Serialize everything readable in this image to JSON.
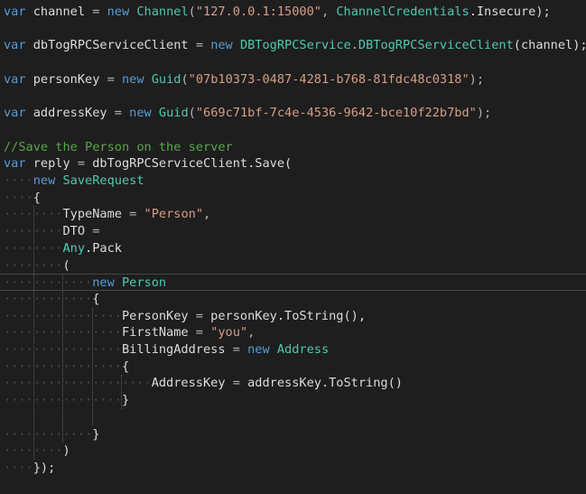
{
  "code": {
    "language": "csharp",
    "lines": [
      [
        {
          "t": "var",
          "c": "kw"
        },
        {
          "t": " channel ",
          "c": "id"
        },
        {
          "t": "=",
          "c": "pun"
        },
        {
          "t": " ",
          "c": "id"
        },
        {
          "t": "new",
          "c": "kw"
        },
        {
          "t": " ",
          "c": "id"
        },
        {
          "t": "Channel",
          "c": "typ"
        },
        {
          "t": "(",
          "c": "pun"
        },
        {
          "t": "\"127.0.0.1:15000\"",
          "c": "str"
        },
        {
          "t": ", ",
          "c": "pun"
        },
        {
          "t": "ChannelCredentials",
          "c": "typ"
        },
        {
          "t": ".Insecure);",
          "c": "id"
        }
      ],
      [],
      [
        {
          "t": "var",
          "c": "kw"
        },
        {
          "t": " dbTogRPCServiceClient ",
          "c": "id"
        },
        {
          "t": "=",
          "c": "pun"
        },
        {
          "t": " ",
          "c": "id"
        },
        {
          "t": "new",
          "c": "kw"
        },
        {
          "t": " ",
          "c": "id"
        },
        {
          "t": "DBTogRPCService",
          "c": "typ"
        },
        {
          "t": ".",
          "c": "pun"
        },
        {
          "t": "DBTogRPCServiceClient",
          "c": "typ"
        },
        {
          "t": "(channel);",
          "c": "id"
        }
      ],
      [],
      [
        {
          "t": "var",
          "c": "kw"
        },
        {
          "t": " personKey ",
          "c": "id"
        },
        {
          "t": "=",
          "c": "pun"
        },
        {
          "t": " ",
          "c": "id"
        },
        {
          "t": "new",
          "c": "kw"
        },
        {
          "t": " ",
          "c": "id"
        },
        {
          "t": "Guid",
          "c": "typ"
        },
        {
          "t": "(",
          "c": "pun"
        },
        {
          "t": "\"07b10373-0487-4281-b768-81fdc48c0318\"",
          "c": "str"
        },
        {
          "t": ");",
          "c": "pun"
        }
      ],
      [],
      [
        {
          "t": "var",
          "c": "kw"
        },
        {
          "t": " addressKey ",
          "c": "id"
        },
        {
          "t": "=",
          "c": "pun"
        },
        {
          "t": " ",
          "c": "id"
        },
        {
          "t": "new",
          "c": "kw"
        },
        {
          "t": " ",
          "c": "id"
        },
        {
          "t": "Guid",
          "c": "typ"
        },
        {
          "t": "(",
          "c": "pun"
        },
        {
          "t": "\"669c71bf-7c4e-4536-9642-bce10f22b7bd\"",
          "c": "str"
        },
        {
          "t": ");",
          "c": "pun"
        }
      ],
      [],
      [
        {
          "t": "//Save the Person on the server",
          "c": "cmt"
        }
      ],
      [
        {
          "t": "var",
          "c": "kw"
        },
        {
          "t": " reply ",
          "c": "id"
        },
        {
          "t": "=",
          "c": "pun"
        },
        {
          "t": " dbTogRPCServiceClient.Save(",
          "c": "id"
        }
      ],
      [
        {
          "t": "    ",
          "c": "ind"
        },
        {
          "t": "new",
          "c": "kw"
        },
        {
          "t": " ",
          "c": "id"
        },
        {
          "t": "SaveRequest",
          "c": "typ"
        }
      ],
      [
        {
          "t": "    ",
          "c": "ind"
        },
        {
          "t": "{",
          "c": "id"
        }
      ],
      [
        {
          "t": "        ",
          "c": "ind"
        },
        {
          "t": "TypeName ",
          "c": "id"
        },
        {
          "t": "=",
          "c": "pun"
        },
        {
          "t": " ",
          "c": "id"
        },
        {
          "t": "\"Person\"",
          "c": "str"
        },
        {
          "t": ",",
          "c": "pun"
        }
      ],
      [
        {
          "t": "        ",
          "c": "ind"
        },
        {
          "t": "DTO ",
          "c": "id"
        },
        {
          "t": "=",
          "c": "pun"
        }
      ],
      [
        {
          "t": "        ",
          "c": "ind"
        },
        {
          "t": "Any",
          "c": "typ"
        },
        {
          "t": ".Pack",
          "c": "id"
        }
      ],
      [
        {
          "t": "        ",
          "c": "ind"
        },
        {
          "t": "(",
          "c": "id"
        }
      ],
      [
        {
          "t": "            ",
          "c": "ind"
        },
        {
          "t": "new",
          "c": "kw"
        },
        {
          "t": " ",
          "c": "id"
        },
        {
          "t": "Person",
          "c": "typ"
        }
      ],
      [
        {
          "t": "            ",
          "c": "ind"
        },
        {
          "t": "{",
          "c": "id"
        }
      ],
      [
        {
          "t": "                ",
          "c": "ind"
        },
        {
          "t": "PersonKey ",
          "c": "id"
        },
        {
          "t": "=",
          "c": "pun"
        },
        {
          "t": " personKey.ToString(),",
          "c": "id"
        }
      ],
      [
        {
          "t": "                ",
          "c": "ind"
        },
        {
          "t": "FirstName ",
          "c": "id"
        },
        {
          "t": "=",
          "c": "pun"
        },
        {
          "t": " ",
          "c": "id"
        },
        {
          "t": "\"you\"",
          "c": "str"
        },
        {
          "t": ",",
          "c": "pun"
        }
      ],
      [
        {
          "t": "                ",
          "c": "ind"
        },
        {
          "t": "BillingAddress ",
          "c": "id"
        },
        {
          "t": "=",
          "c": "pun"
        },
        {
          "t": " ",
          "c": "id"
        },
        {
          "t": "new",
          "c": "kw"
        },
        {
          "t": " ",
          "c": "id"
        },
        {
          "t": "Address",
          "c": "typ"
        }
      ],
      [
        {
          "t": "                ",
          "c": "ind"
        },
        {
          "t": "{",
          "c": "id"
        }
      ],
      [
        {
          "t": "                    ",
          "c": "ind"
        },
        {
          "t": "AddressKey ",
          "c": "id"
        },
        {
          "t": "=",
          "c": "pun"
        },
        {
          "t": " addressKey.ToString()",
          "c": "id"
        }
      ],
      [
        {
          "t": "                ",
          "c": "ind"
        },
        {
          "t": "}",
          "c": "id"
        }
      ],
      [],
      [
        {
          "t": "            ",
          "c": "ind"
        },
        {
          "t": "}",
          "c": "id"
        }
      ],
      [
        {
          "t": "        ",
          "c": "ind"
        },
        {
          "t": ")",
          "c": "id"
        }
      ],
      [
        {
          "t": "    ",
          "c": "ind"
        },
        {
          "t": "});",
          "c": "id"
        }
      ]
    ],
    "current_line_index": 16
  },
  "colors": {
    "background": "#1e1e1e",
    "keyword": "#569cd6",
    "identifier": "#dcdcdc",
    "type": "#4ec9b0",
    "string": "#d69d85",
    "comment": "#57a64a",
    "indent_guide": "#5a5a5a"
  }
}
